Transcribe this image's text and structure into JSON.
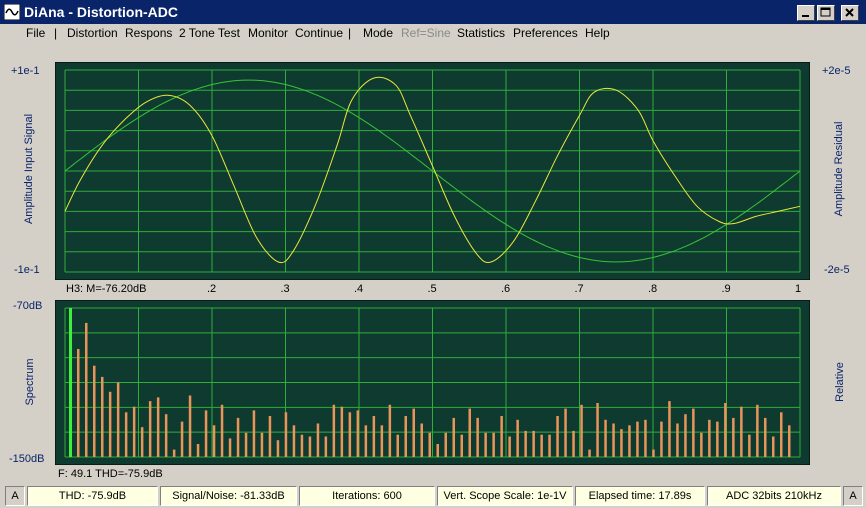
{
  "window": {
    "title": "DiAna - Distortion-ADC"
  },
  "menu": {
    "file": "File",
    "sep1": "|",
    "distortion": "Distortion",
    "respons": "Respons",
    "tone2": "2 Tone Test",
    "monitor": "Monitor",
    "continue": "Continue",
    "sep2": "|",
    "mode": "Mode",
    "ref_sine": "Ref=Sine",
    "statistics": "Statistics",
    "preferences": "Preferences",
    "help": "Help"
  },
  "scope": {
    "left_label": "Amplitude Input Signal",
    "right_label": "Amplitude Residual",
    "y_top_left": "+1e-1",
    "y_bottom_left": "-1e-1",
    "y_top_right": "+2e-5",
    "y_bottom_right": "-2e-5",
    "harmonic_readout": "H3: M=-76.20dB",
    "x_ticks": [
      ".2",
      ".3",
      ".4",
      ".5",
      ".6",
      ".7",
      ".8",
      ".9",
      "1"
    ]
  },
  "spectrum": {
    "left_label": "Spectrum",
    "right_label": "Relative",
    "y_top": "-70dB",
    "y_bottom": "-150dB",
    "readout": "F: 49.1  THD=-75.9dB"
  },
  "status": {
    "left_flag": "A",
    "thd": "THD:  -75.9dB",
    "snr": "Signal/Noise: -81.33dB",
    "iterations": "Iterations: 600",
    "scope_scale": "Vert. Scope Scale: 1e-1V",
    "elapsed": "Elapsed time: 17.89s",
    "adc": "ADC 32bits 210kHz",
    "right_flag": "A"
  },
  "colors": {
    "plot_bg": "#0f3a30",
    "grid": "#2fae3a",
    "input_trace": "#36c436",
    "residual_trace": "#e8e83c",
    "harmonic_bar": "#e8955a",
    "fundamental_bar": "#3cf03c",
    "label_text": "#0a246a"
  },
  "chart_data": [
    {
      "type": "line",
      "title": "",
      "x_range": [
        0,
        1
      ],
      "series": [
        {
          "role": "input_signal",
          "wave": "sine",
          "cycles": 1,
          "amplitude_fraction": 0.9
        },
        {
          "role": "residual",
          "x": [
            0,
            0.02,
            0.05,
            0.08,
            0.11,
            0.14,
            0.17,
            0.2,
            0.23,
            0.26,
            0.29,
            0.31,
            0.34,
            0.37,
            0.39,
            0.42,
            0.45,
            0.47,
            0.5,
            0.53,
            0.56,
            0.58,
            0.61,
            0.64,
            0.67,
            0.7,
            0.72,
            0.75,
            0.78,
            0.8,
            0.83,
            0.86,
            0.89,
            0.91,
            0.94,
            0.97,
            1.0
          ],
          "y": [
            -0.4,
            -0.1,
            0.25,
            0.5,
            0.68,
            0.75,
            0.65,
            0.35,
            -0.15,
            -0.65,
            -0.9,
            -0.8,
            -0.35,
            0.25,
            0.7,
            0.92,
            0.85,
            0.55,
            0.05,
            -0.45,
            -0.82,
            -0.9,
            -0.7,
            -0.3,
            0.15,
            0.55,
            0.78,
            0.8,
            0.6,
            0.3,
            -0.05,
            -0.35,
            -0.5,
            -0.52,
            -0.45,
            -0.4,
            -0.35
          ]
        }
      ]
    },
    {
      "type": "bar",
      "y_range_db": [
        -150,
        -70
      ],
      "fundamental_db": -70,
      "harmonics_db": [
        -92,
        -78,
        -101,
        -107,
        -115,
        -110,
        -126,
        -123,
        -134,
        -120,
        -118,
        -127,
        -146,
        -131,
        -117,
        -143,
        -125,
        -133,
        -122,
        -140,
        -129,
        -137,
        -125,
        -137,
        -128,
        -141,
        -126,
        -133,
        -138,
        -139,
        -132,
        -139,
        -122,
        -123,
        -126,
        -125,
        -133,
        -128,
        -133,
        -122,
        -138,
        -128,
        -124,
        -132,
        -137,
        -143,
        -137,
        -129,
        -138,
        -124,
        -129,
        -137,
        -137,
        -128,
        -139,
        -130,
        -136,
        -136,
        -138,
        -138,
        -128,
        -124,
        -136,
        -122,
        -146,
        -121,
        -130,
        -132,
        -135,
        -133,
        -131,
        -130,
        -146,
        -131,
        -120,
        -132,
        -127,
        -124,
        -137,
        -130,
        -131,
        -121,
        -129,
        -123,
        -138,
        -122,
        -129,
        -139,
        -126,
        -133
      ]
    }
  ]
}
